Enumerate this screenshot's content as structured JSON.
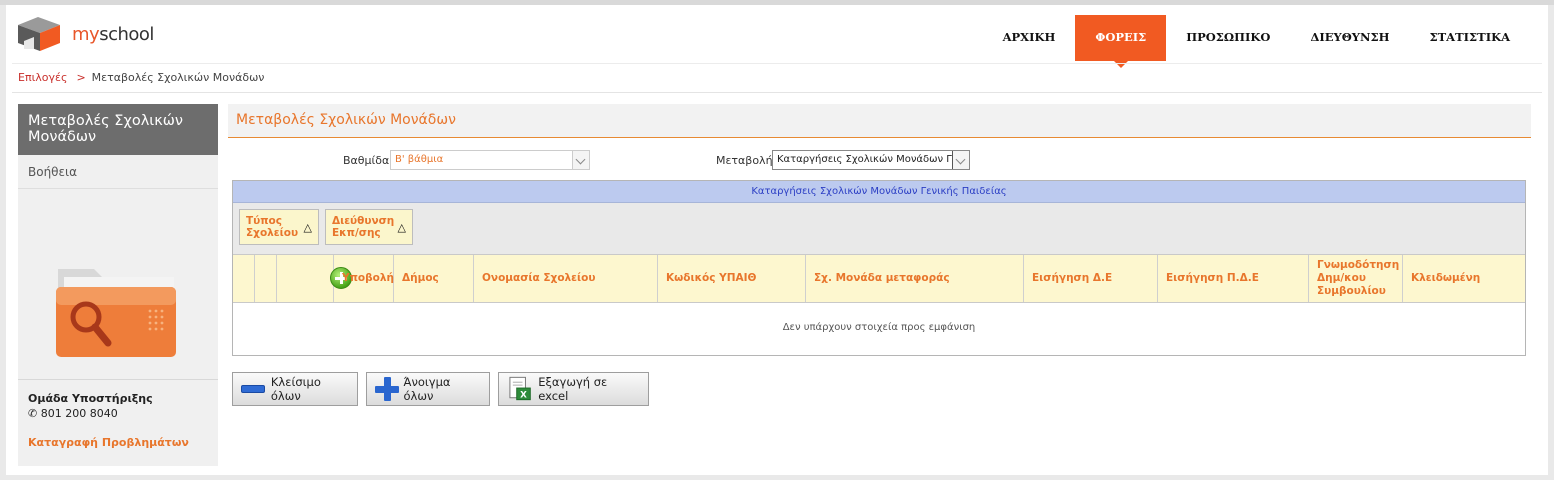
{
  "header": {
    "logo_text_my": "my",
    "logo_text_school": "school",
    "nav": [
      {
        "label": "ΑΡΧΙΚΗ",
        "active": false
      },
      {
        "label": "ΦΟΡΕΙΣ",
        "active": true
      },
      {
        "label": "ΠΡΟΣΩΠΙΚΟ",
        "active": false
      },
      {
        "label": "ΔΙΕΥΘΥΝΣΗ",
        "active": false
      },
      {
        "label": "ΣΤΑΤΙΣΤΙΚΑ",
        "active": false
      }
    ]
  },
  "breadcrumb": {
    "root": "Επιλογές",
    "separator": ">",
    "current": "Μεταβολές Σχολικών Μονάδων"
  },
  "sidebar": {
    "title": "Μεταβολές Σχολικών Μονάδων",
    "help": "Βοήθεια",
    "support_title": "Ομάδα Υποστήριξης",
    "support_phone": "801 200 8040",
    "report_link": "Καταγραφή Προβλημάτων"
  },
  "main": {
    "title": "Μεταβολές Σχολικών Μονάδων",
    "filters": {
      "grade_label": "Βαθμίδα",
      "grade_value": "Β' βάθμια",
      "change_label": "Μεταβολή",
      "change_value": "Καταργήσεις Σχολικών Μονάδων Γενικ"
    },
    "grid": {
      "caption": "Καταργήσεις Σχολικών Μονάδων Γενικής Παιδείας",
      "group_buttons": [
        "Τύπος Σχολείου",
        "Διεύθυνση Εκπ/σης"
      ],
      "group_sort_icon": "△",
      "columns": [
        "Υποβολή",
        "Δήμος",
        "Ονομασία Σχολείου",
        "Κωδικός ΥΠΑΙΘ",
        "Σχ. Μονάδα μεταφοράς",
        "Εισήγηση Δ.Ε",
        "Εισήγηση Π.Δ.Ε",
        "Γνωμοδότηση Δημ/κου Συμβουλίου",
        "Κλειδωμένη"
      ],
      "empty_text": "Δεν υπάρχουν στοιχεία προς εμφάνιση"
    },
    "buttons": {
      "collapse_all": "Κλείσιμο όλων",
      "expand_all": "Άνοιγμα όλων",
      "export_excel": "Εξαγωγή σε excel"
    }
  },
  "colors": {
    "accent_orange": "#f15a22",
    "label_orange": "#e8762c",
    "caption_blue": "#bccaef",
    "header_yellow": "#fdf7cf"
  }
}
